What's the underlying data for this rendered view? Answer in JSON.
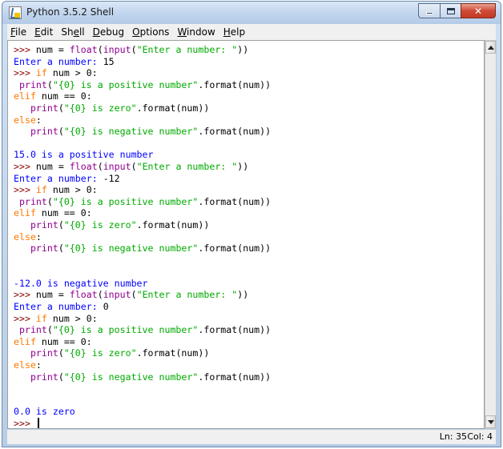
{
  "window": {
    "title": "Python 3.5.2 Shell",
    "close_glyph": "✕"
  },
  "menu": [
    "File",
    "Edit",
    "Shell",
    "Debug",
    "Options",
    "Window",
    "Help"
  ],
  "menu_mnemonics": [
    "F",
    "E",
    "e",
    "D",
    "O",
    "W",
    "H"
  ],
  "code_lines": [
    [
      [
        "p",
        ">>> "
      ],
      [
        "in",
        "num = "
      ],
      [
        "bi",
        "float"
      ],
      [
        "in",
        "("
      ],
      [
        "bi",
        "input"
      ],
      [
        "in",
        "("
      ],
      [
        "st",
        "\"Enter a number: \""
      ],
      [
        "in",
        "))"
      ]
    ],
    [
      [
        "out",
        "Enter a number: "
      ],
      [
        "in",
        "15"
      ]
    ],
    [
      [
        "p",
        ">>> "
      ],
      [
        "kw",
        "if"
      ],
      [
        "in",
        " num > 0:"
      ]
    ],
    [
      [
        "in",
        " "
      ],
      [
        "bi",
        "print"
      ],
      [
        "in",
        "("
      ],
      [
        "st",
        "\"{0} is a positive number\""
      ],
      [
        "in",
        ".format(num))"
      ]
    ],
    [
      [
        "kw",
        "elif"
      ],
      [
        "in",
        " num == 0:"
      ]
    ],
    [
      [
        "in",
        "   "
      ],
      [
        "bi",
        "print"
      ],
      [
        "in",
        "("
      ],
      [
        "st",
        "\"{0} is zero\""
      ],
      [
        "in",
        ".format(num))"
      ]
    ],
    [
      [
        "kw",
        "else"
      ],
      [
        "in",
        ":"
      ]
    ],
    [
      [
        "in",
        "   "
      ],
      [
        "bi",
        "print"
      ],
      [
        "in",
        "("
      ],
      [
        "st",
        "\"{0} is negative number\""
      ],
      [
        "in",
        ".format(num))"
      ]
    ],
    [],
    [
      [
        "out",
        "15.0 is a positive number"
      ]
    ],
    [
      [
        "p",
        ">>> "
      ],
      [
        "in",
        "num = "
      ],
      [
        "bi",
        "float"
      ],
      [
        "in",
        "("
      ],
      [
        "bi",
        "input"
      ],
      [
        "in",
        "("
      ],
      [
        "st",
        "\"Enter a number: \""
      ],
      [
        "in",
        "))"
      ]
    ],
    [
      [
        "out",
        "Enter a number: "
      ],
      [
        "in",
        "-12"
      ]
    ],
    [
      [
        "p",
        ">>> "
      ],
      [
        "kw",
        "if"
      ],
      [
        "in",
        " num > 0:"
      ]
    ],
    [
      [
        "in",
        " "
      ],
      [
        "bi",
        "print"
      ],
      [
        "in",
        "("
      ],
      [
        "st",
        "\"{0} is a positive number\""
      ],
      [
        "in",
        ".format(num))"
      ]
    ],
    [
      [
        "kw",
        "elif"
      ],
      [
        "in",
        " num == 0:"
      ]
    ],
    [
      [
        "in",
        "   "
      ],
      [
        "bi",
        "print"
      ],
      [
        "in",
        "("
      ],
      [
        "st",
        "\"{0} is zero\""
      ],
      [
        "in",
        ".format(num))"
      ]
    ],
    [
      [
        "kw",
        "else"
      ],
      [
        "in",
        ":"
      ]
    ],
    [
      [
        "in",
        "   "
      ],
      [
        "bi",
        "print"
      ],
      [
        "in",
        "("
      ],
      [
        "st",
        "\"{0} is negative number\""
      ],
      [
        "in",
        ".format(num))"
      ]
    ],
    [],
    [],
    [
      [
        "out",
        "-12.0 is negative number"
      ]
    ],
    [
      [
        "p",
        ">>> "
      ],
      [
        "in",
        "num = "
      ],
      [
        "bi",
        "float"
      ],
      [
        "in",
        "("
      ],
      [
        "bi",
        "input"
      ],
      [
        "in",
        "("
      ],
      [
        "st",
        "\"Enter a number: \""
      ],
      [
        "in",
        "))"
      ]
    ],
    [
      [
        "out",
        "Enter a number: "
      ],
      [
        "in",
        "0"
      ]
    ],
    [
      [
        "p",
        ">>> "
      ],
      [
        "kw",
        "if"
      ],
      [
        "in",
        " num > 0:"
      ]
    ],
    [
      [
        "in",
        " "
      ],
      [
        "bi",
        "print"
      ],
      [
        "in",
        "("
      ],
      [
        "st",
        "\"{0} is a positive number\""
      ],
      [
        "in",
        ".format(num))"
      ]
    ],
    [
      [
        "kw",
        "elif"
      ],
      [
        "in",
        " num == 0:"
      ]
    ],
    [
      [
        "in",
        "   "
      ],
      [
        "bi",
        "print"
      ],
      [
        "in",
        "("
      ],
      [
        "st",
        "\"{0} is zero\""
      ],
      [
        "in",
        ".format(num))"
      ]
    ],
    [
      [
        "kw",
        "else"
      ],
      [
        "in",
        ":"
      ]
    ],
    [
      [
        "in",
        "   "
      ],
      [
        "bi",
        "print"
      ],
      [
        "in",
        "("
      ],
      [
        "st",
        "\"{0} is negative number\""
      ],
      [
        "in",
        ".format(num))"
      ]
    ],
    [],
    [],
    [
      [
        "out",
        "0.0 is zero"
      ]
    ],
    [
      [
        "p",
        ">>> "
      ]
    ]
  ],
  "status": {
    "line": "Ln: 35",
    "col": "Col: 4"
  }
}
